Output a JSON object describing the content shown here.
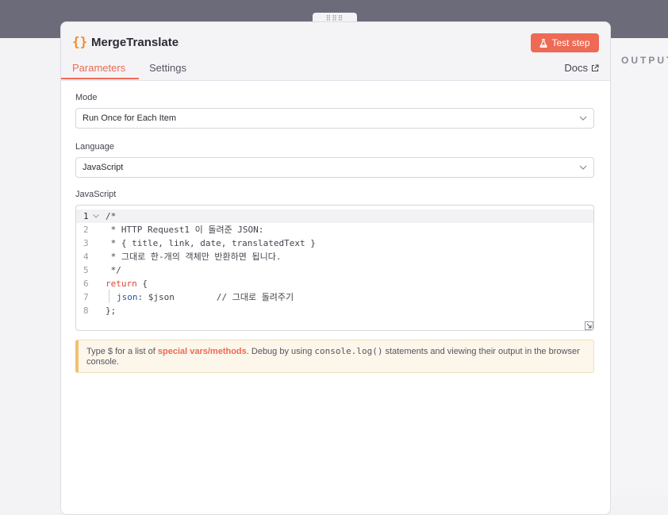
{
  "background": {
    "output_label": "OUTPUT"
  },
  "panel": {
    "title_icon": "{}",
    "title": "MergeTranslate",
    "test_button": "Test step",
    "tabs": [
      {
        "label": "Parameters",
        "active": true
      },
      {
        "label": "Settings",
        "active": false
      }
    ],
    "docs_label": "Docs"
  },
  "fields": {
    "mode": {
      "label": "Mode",
      "value": "Run Once for Each Item"
    },
    "language": {
      "label": "Language",
      "value": "JavaScript"
    },
    "code": {
      "label": "JavaScript"
    }
  },
  "code_lines": [
    {
      "num": "1",
      "text": "/*"
    },
    {
      "num": "2",
      "text": " * HTTP Request1 이 돌려준 JSON:"
    },
    {
      "num": "3",
      "text": " * { title, link, date, translatedText }"
    },
    {
      "num": "4",
      "text": " * 그대로 한-개의 객체만 반환하면 됩니다."
    },
    {
      "num": "5",
      "text": " */"
    },
    {
      "num": "6",
      "kw": "return",
      "rest": " {"
    },
    {
      "num": "7",
      "prop": "json",
      "rest": ": $json        // 그대로 돌려주기"
    },
    {
      "num": "8",
      "text": "};"
    }
  ],
  "hint": {
    "p1": "Type $ for a list of ",
    "link": "special vars/methods",
    "p2": ". Debug by using ",
    "code": "console.log()",
    "p3": " statements and viewing their output in the browser console."
  },
  "colors": {
    "accent": "#ee6a55",
    "icon_orange": "#f08a2b",
    "hint_border": "#f2c06d"
  }
}
